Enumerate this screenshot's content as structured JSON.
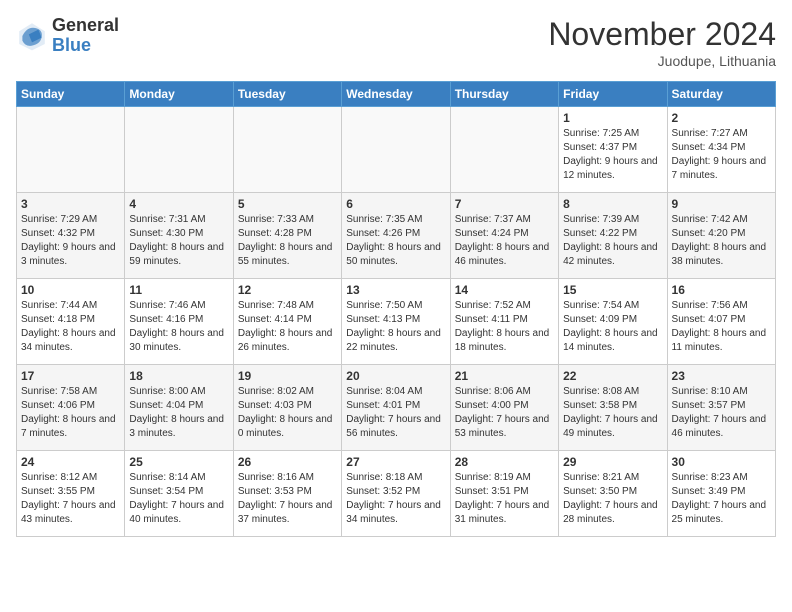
{
  "header": {
    "logo_general": "General",
    "logo_blue": "Blue",
    "month_title": "November 2024",
    "location": "Juodupe, Lithuania"
  },
  "weekdays": [
    "Sunday",
    "Monday",
    "Tuesday",
    "Wednesday",
    "Thursday",
    "Friday",
    "Saturday"
  ],
  "weeks": [
    [
      {
        "day": "",
        "info": ""
      },
      {
        "day": "",
        "info": ""
      },
      {
        "day": "",
        "info": ""
      },
      {
        "day": "",
        "info": ""
      },
      {
        "day": "",
        "info": ""
      },
      {
        "day": "1",
        "info": "Sunrise: 7:25 AM\nSunset: 4:37 PM\nDaylight: 9 hours and 12 minutes."
      },
      {
        "day": "2",
        "info": "Sunrise: 7:27 AM\nSunset: 4:34 PM\nDaylight: 9 hours and 7 minutes."
      }
    ],
    [
      {
        "day": "3",
        "info": "Sunrise: 7:29 AM\nSunset: 4:32 PM\nDaylight: 9 hours and 3 minutes."
      },
      {
        "day": "4",
        "info": "Sunrise: 7:31 AM\nSunset: 4:30 PM\nDaylight: 8 hours and 59 minutes."
      },
      {
        "day": "5",
        "info": "Sunrise: 7:33 AM\nSunset: 4:28 PM\nDaylight: 8 hours and 55 minutes."
      },
      {
        "day": "6",
        "info": "Sunrise: 7:35 AM\nSunset: 4:26 PM\nDaylight: 8 hours and 50 minutes."
      },
      {
        "day": "7",
        "info": "Sunrise: 7:37 AM\nSunset: 4:24 PM\nDaylight: 8 hours and 46 minutes."
      },
      {
        "day": "8",
        "info": "Sunrise: 7:39 AM\nSunset: 4:22 PM\nDaylight: 8 hours and 42 minutes."
      },
      {
        "day": "9",
        "info": "Sunrise: 7:42 AM\nSunset: 4:20 PM\nDaylight: 8 hours and 38 minutes."
      }
    ],
    [
      {
        "day": "10",
        "info": "Sunrise: 7:44 AM\nSunset: 4:18 PM\nDaylight: 8 hours and 34 minutes."
      },
      {
        "day": "11",
        "info": "Sunrise: 7:46 AM\nSunset: 4:16 PM\nDaylight: 8 hours and 30 minutes."
      },
      {
        "day": "12",
        "info": "Sunrise: 7:48 AM\nSunset: 4:14 PM\nDaylight: 8 hours and 26 minutes."
      },
      {
        "day": "13",
        "info": "Sunrise: 7:50 AM\nSunset: 4:13 PM\nDaylight: 8 hours and 22 minutes."
      },
      {
        "day": "14",
        "info": "Sunrise: 7:52 AM\nSunset: 4:11 PM\nDaylight: 8 hours and 18 minutes."
      },
      {
        "day": "15",
        "info": "Sunrise: 7:54 AM\nSunset: 4:09 PM\nDaylight: 8 hours and 14 minutes."
      },
      {
        "day": "16",
        "info": "Sunrise: 7:56 AM\nSunset: 4:07 PM\nDaylight: 8 hours and 11 minutes."
      }
    ],
    [
      {
        "day": "17",
        "info": "Sunrise: 7:58 AM\nSunset: 4:06 PM\nDaylight: 8 hours and 7 minutes."
      },
      {
        "day": "18",
        "info": "Sunrise: 8:00 AM\nSunset: 4:04 PM\nDaylight: 8 hours and 3 minutes."
      },
      {
        "day": "19",
        "info": "Sunrise: 8:02 AM\nSunset: 4:03 PM\nDaylight: 8 hours and 0 minutes."
      },
      {
        "day": "20",
        "info": "Sunrise: 8:04 AM\nSunset: 4:01 PM\nDaylight: 7 hours and 56 minutes."
      },
      {
        "day": "21",
        "info": "Sunrise: 8:06 AM\nSunset: 4:00 PM\nDaylight: 7 hours and 53 minutes."
      },
      {
        "day": "22",
        "info": "Sunrise: 8:08 AM\nSunset: 3:58 PM\nDaylight: 7 hours and 49 minutes."
      },
      {
        "day": "23",
        "info": "Sunrise: 8:10 AM\nSunset: 3:57 PM\nDaylight: 7 hours and 46 minutes."
      }
    ],
    [
      {
        "day": "24",
        "info": "Sunrise: 8:12 AM\nSunset: 3:55 PM\nDaylight: 7 hours and 43 minutes."
      },
      {
        "day": "25",
        "info": "Sunrise: 8:14 AM\nSunset: 3:54 PM\nDaylight: 7 hours and 40 minutes."
      },
      {
        "day": "26",
        "info": "Sunrise: 8:16 AM\nSunset: 3:53 PM\nDaylight: 7 hours and 37 minutes."
      },
      {
        "day": "27",
        "info": "Sunrise: 8:18 AM\nSunset: 3:52 PM\nDaylight: 7 hours and 34 minutes."
      },
      {
        "day": "28",
        "info": "Sunrise: 8:19 AM\nSunset: 3:51 PM\nDaylight: 7 hours and 31 minutes."
      },
      {
        "day": "29",
        "info": "Sunrise: 8:21 AM\nSunset: 3:50 PM\nDaylight: 7 hours and 28 minutes."
      },
      {
        "day": "30",
        "info": "Sunrise: 8:23 AM\nSunset: 3:49 PM\nDaylight: 7 hours and 25 minutes."
      }
    ]
  ]
}
